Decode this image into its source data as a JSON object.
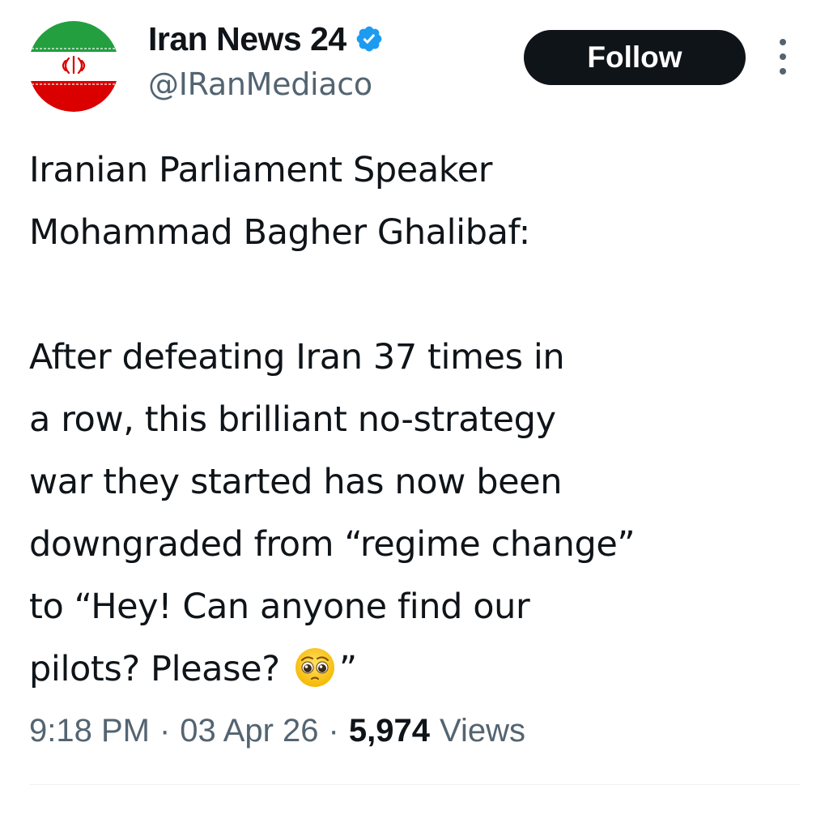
{
  "author": {
    "display_name": "Iran News 24",
    "handle": "@IRanMediaco",
    "avatar_icon": "iran-flag-avatar",
    "verified_icon": "verified-badge-icon",
    "verified_color": "#1d9bf0"
  },
  "actions": {
    "follow_label": "Follow",
    "more_icon": "more-options-icon"
  },
  "tweet": {
    "lines_a": [
      "Iranian Parliament Speaker",
      "Mohammad Bagher Ghalibaf:"
    ],
    "lines_b": [
      "After defeating Iran 37 times in",
      "a row, this brilliant no-strategy",
      "war they started has now been",
      "downgraded from “regime change”",
      "to “Hey! Can anyone find our"
    ],
    "last_line_text": "pilots? Please?",
    "emoji_icon": "pleading-face-emoji",
    "last_line_close": "”"
  },
  "meta": {
    "time": "9:18 PM",
    "separator": "·",
    "date": "03 Apr 26",
    "views_count": "5,974",
    "views_label": "Views"
  },
  "colors": {
    "text_primary": "#0f1419",
    "text_secondary": "#536471",
    "follow_bg": "#0f1419",
    "follow_text": "#ffffff",
    "flag_green": "#239f40",
    "flag_white": "#ffffff",
    "flag_red": "#da0000"
  }
}
